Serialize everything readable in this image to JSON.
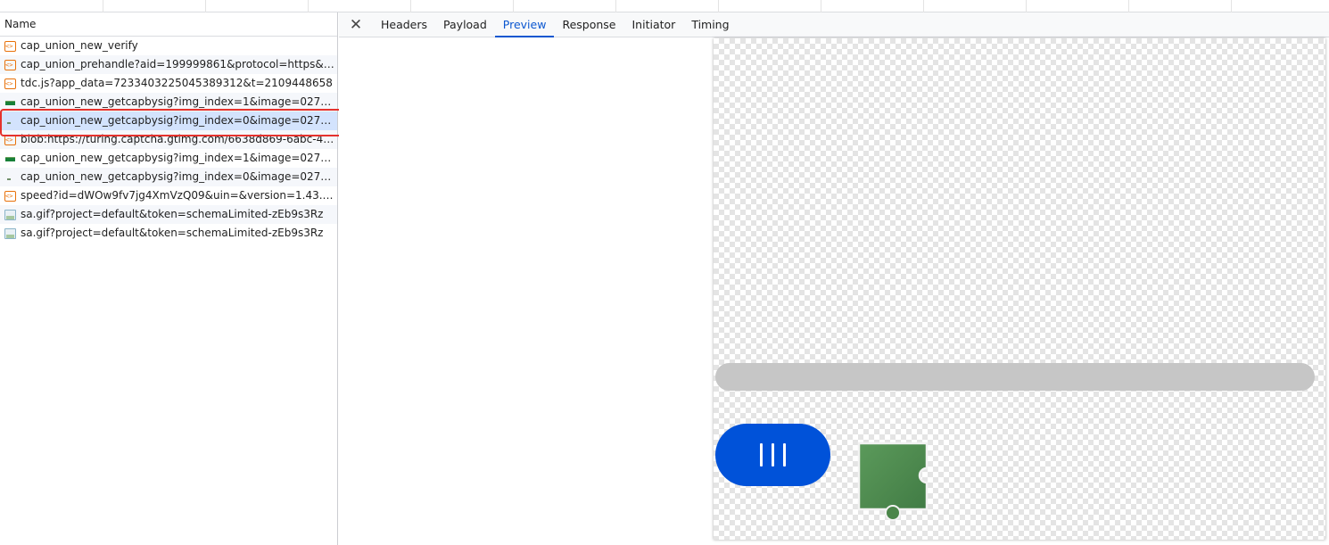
{
  "request_list": {
    "header": "Name",
    "rows": [
      {
        "name": "cap_union_new_verify",
        "icon": "script-icon"
      },
      {
        "name": "cap_union_prehandle?aid=199999861&protocol=https&a...n...",
        "icon": "script-icon"
      },
      {
        "name": "tdc.js?app_data=7233403225045389312&t=2109448658",
        "icon": "script-icon"
      },
      {
        "name": "cap_union_new_getcapbysig?img_index=1&image=027905...",
        "icon": "image-icon"
      },
      {
        "name": "cap_union_new_getcapbysig?img_index=0&image=027905...",
        "icon": "image-small-icon",
        "selected": true
      },
      {
        "name": "blob:https://turing.captcha.gtimg.com/6638d869-6abc-4e2...",
        "icon": "script-icon"
      },
      {
        "name": "cap_union_new_getcapbysig?img_index=1&image=027905...",
        "icon": "image-icon"
      },
      {
        "name": "cap_union_new_getcapbysig?img_index=0&image=027905...",
        "icon": "image-small-icon"
      },
      {
        "name": "speed?id=dWOw9fv7jg4XmVzQ09&uin=&version=1.43.6&ai...",
        "icon": "script-icon"
      },
      {
        "name": "sa.gif?project=default&token=schemaLimited-zEb9s3Rz",
        "icon": "gif-icon"
      },
      {
        "name": "sa.gif?project=default&token=schemaLimited-zEb9s3Rz",
        "icon": "gif-icon"
      }
    ]
  },
  "details": {
    "close_icon": "close-icon",
    "tabs": [
      {
        "label": "Headers"
      },
      {
        "label": "Payload"
      },
      {
        "label": "Preview",
        "active": true
      },
      {
        "label": "Response"
      },
      {
        "label": "Initiator"
      },
      {
        "label": "Timing"
      }
    ]
  },
  "preview": {
    "background": "checkerboard-transparency",
    "slider_track_color": "#c6c6c6",
    "slider_handle_color": "#0052d9",
    "puzzle_piece_color": "#4e8a4f",
    "highlight_color": "#e5322d"
  }
}
